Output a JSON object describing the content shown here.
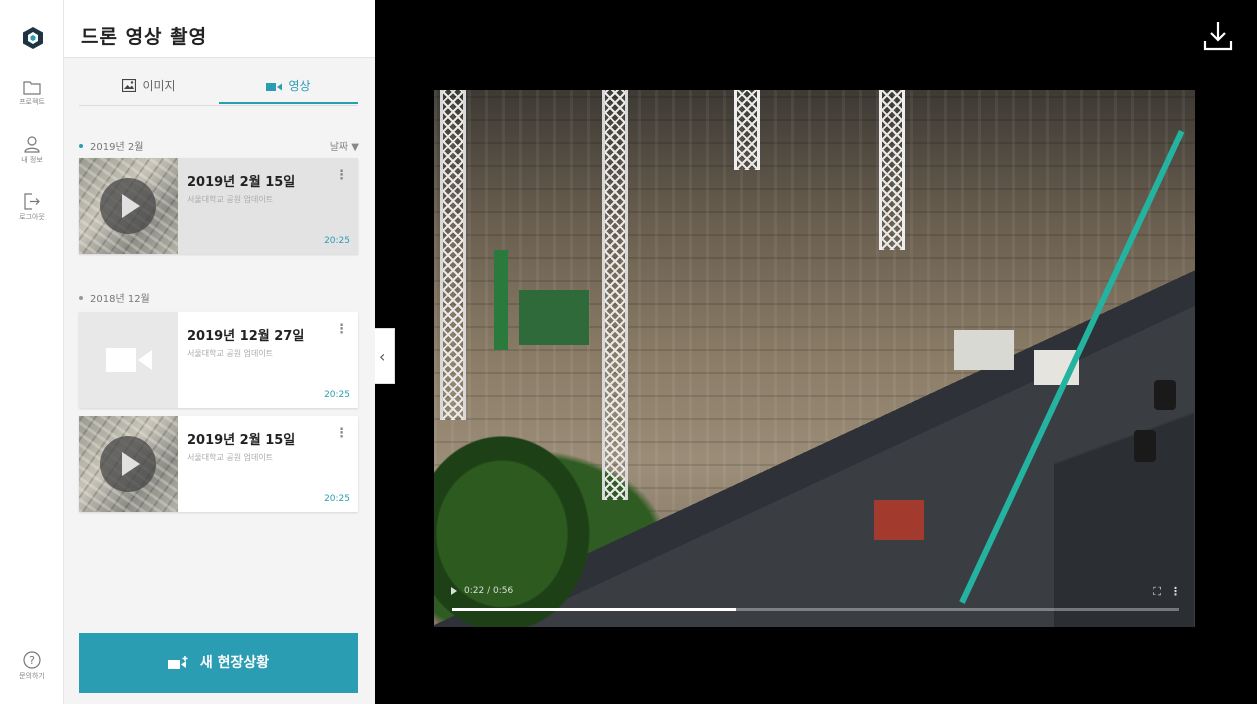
{
  "rail": {
    "items": [
      {
        "label": "프로젝트"
      },
      {
        "label": "내 정보"
      },
      {
        "label": "로그아웃"
      },
      {
        "label": "문의하기"
      }
    ]
  },
  "panel": {
    "title": "드론 영상 촬영",
    "tabs": [
      {
        "label": "이미지",
        "icon": "image-icon",
        "active": false
      },
      {
        "label": "영상",
        "icon": "video-camera-icon",
        "active": true
      }
    ],
    "sort_label": "날짜 ▼",
    "groups": [
      {
        "label": "2019년 2월",
        "items": [
          {
            "title": "2019년 2월 15일",
            "subtitle": "서울대학교 공원 업데이트",
            "duration": "20:25",
            "thumb": "aerial",
            "selected": true
          }
        ]
      },
      {
        "label": "2018년 12월",
        "items": [
          {
            "title": "2019년 12월 27일",
            "subtitle": "서울대학교 공원 업데이트",
            "duration": "20:25",
            "thumb": "placeholder",
            "selected": false
          },
          {
            "title": "2019년 2월 15일",
            "subtitle": "서울대학교 공원 업데이트",
            "duration": "20:25",
            "thumb": "aerial",
            "selected": false
          }
        ]
      }
    ],
    "new_button_label": "새 현장상황"
  },
  "viewer": {
    "time_label": "0:22 / 0:56",
    "progress": 0.39
  },
  "colors": {
    "accent": "#2a9db2",
    "viewer_bg": "#000000",
    "panel_bg": "#f4f4f4"
  }
}
